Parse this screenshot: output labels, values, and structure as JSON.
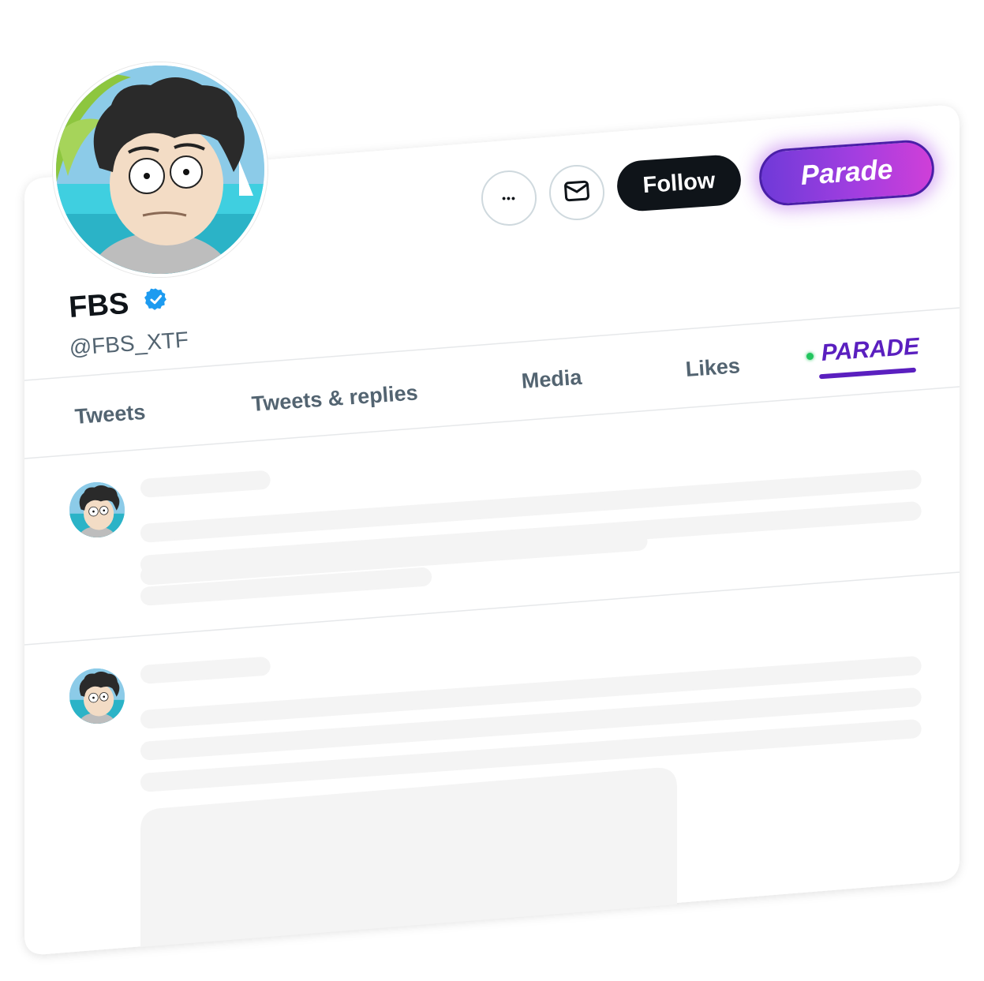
{
  "profile": {
    "name": "FBS",
    "handle": "@FBS_XTF",
    "verified": true
  },
  "actions": {
    "more_label": "•••",
    "follow_label": "Follow",
    "parade_label": "Parade"
  },
  "tabs": [
    {
      "label": "Tweets"
    },
    {
      "label": "Tweets & replies"
    },
    {
      "label": "Media"
    },
    {
      "label": "Likes"
    },
    {
      "label": "PARADE",
      "active": true
    }
  ],
  "colors": {
    "accent": "#5a1fbf",
    "verified": "#1d9bf0",
    "follow_bg": "#0f1419",
    "live_dot": "#22c55e"
  },
  "icons": [
    "more-icon",
    "mail-icon",
    "verified-badge-icon",
    "live-dot-icon"
  ]
}
